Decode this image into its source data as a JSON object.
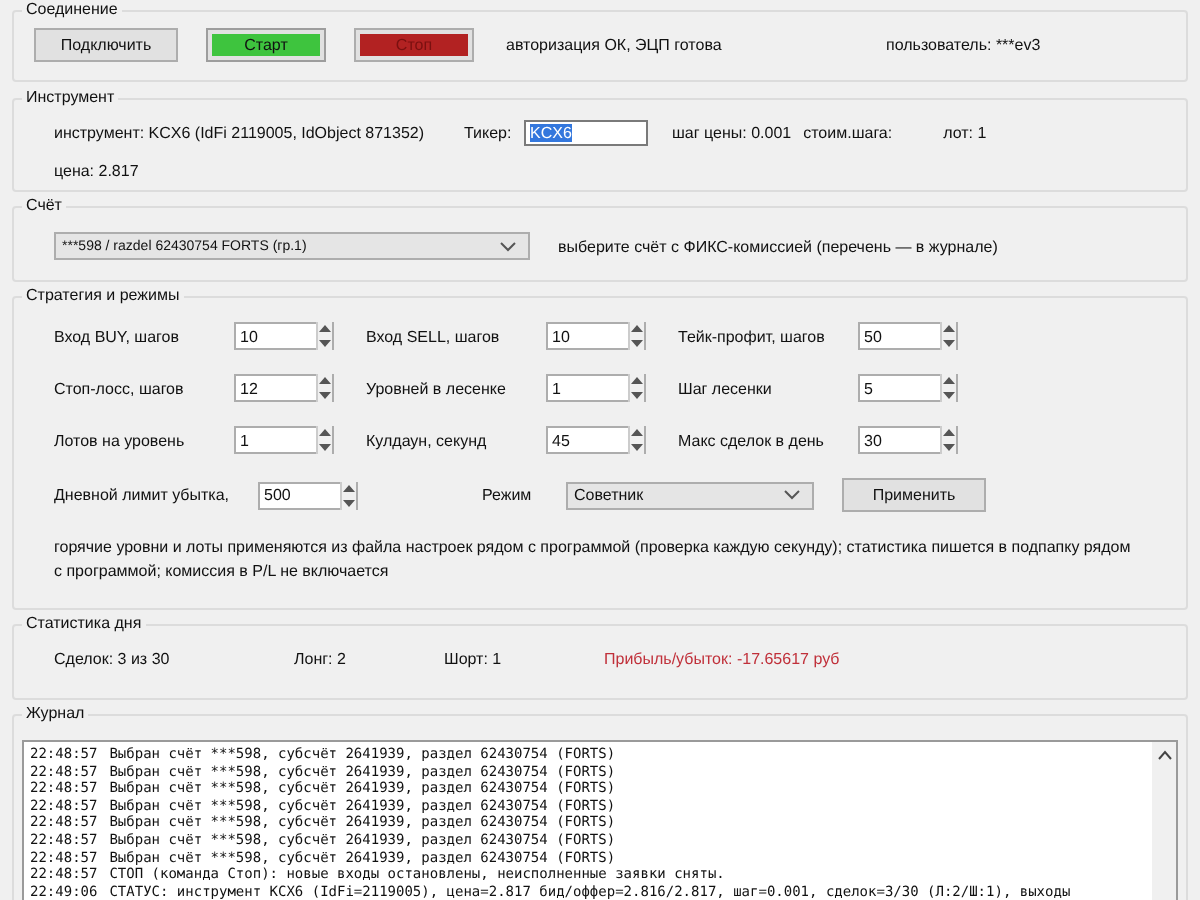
{
  "connection": {
    "title": "Соединение",
    "buttons": [
      {
        "label": "Подключить",
        "kind": "default"
      },
      {
        "label": "Старт",
        "kind": "start"
      },
      {
        "label": "Стоп",
        "kind": "stop"
      }
    ],
    "status": "авторизация ОК, ЭЦП готова",
    "user": "пользователь: ***ev3"
  },
  "instrument": {
    "title": "Инструмент",
    "info": "инструмент: KCX6 (IdFi 2119005, IdObject 871352)",
    "ticker_label": "Тикер:",
    "ticker_value": "KCX6",
    "ticker_text_selected": true,
    "price_step": "шаг цены: 0.001",
    "step_cost": "стоим.шага:",
    "lot": "лот: 1",
    "price": "цена: 2.817"
  },
  "account": {
    "title": "Счёт",
    "value": "***598 / razdel 62430754  FORTS (гр.1)",
    "hint": "выберите счёт с ФИКС-комиссией (перечень — в журнале)"
  },
  "strategy": {
    "title": "Стратегия и режимы",
    "fields": [
      {
        "label": "Вход BUY, шагов",
        "value": "10"
      },
      {
        "label": "Вход SELL, шагов",
        "value": "10"
      },
      {
        "label": "Тейк-профит, шагов",
        "value": "50"
      },
      {
        "label": "Стоп-лосс, шагов",
        "value": "12"
      },
      {
        "label": "Уровней в лесенке",
        "value": "1"
      },
      {
        "label": "Шаг лесенки",
        "value": "5"
      },
      {
        "label": "Лотов на уровень",
        "value": "1"
      },
      {
        "label": "Кулдаун, секунд",
        "value": "45"
      },
      {
        "label": "Макс сделок в день",
        "value": "30"
      }
    ],
    "loss_limit_label": "Дневной лимит убытка,",
    "loss_limit_value": "500",
    "mode_label": "Режим",
    "mode_value": "Советник",
    "apply": "Применить",
    "note": "горячие уровни и лоты применяются из файла настроек рядом с программой (проверка каждую секунду); статистика пишется в подпапку рядом с программой; комиссия в P/L не включается"
  },
  "stats": {
    "title": "Статистика дня",
    "items": [
      {
        "text": "Сделок: 3 из 30",
        "kind": "plain"
      },
      {
        "text": "Лонг: 2",
        "kind": "plain"
      },
      {
        "text": "Шорт: 1",
        "kind": "plain"
      },
      {
        "text": "Прибыль/убыток: -17.65617 руб",
        "kind": "loss"
      }
    ]
  },
  "journal": {
    "title": "Журнал",
    "lines": [
      {
        "time": "22:48:57",
        "text": "Выбран счёт ***598, субсчёт 2641939, раздел 62430754 (FORTS)"
      },
      {
        "time": "22:48:57",
        "text": "Выбран счёт ***598, субсчёт 2641939, раздел 62430754 (FORTS)"
      },
      {
        "time": "22:48:57",
        "text": "Выбран счёт ***598, субсчёт 2641939, раздел 62430754 (FORTS)"
      },
      {
        "time": "22:48:57",
        "text": "Выбран счёт ***598, субсчёт 2641939, раздел 62430754 (FORTS)"
      },
      {
        "time": "22:48:57",
        "text": "Выбран счёт ***598, субсчёт 2641939, раздел 62430754 (FORTS)"
      },
      {
        "time": "22:48:57",
        "text": "Выбран счёт ***598, субсчёт 2641939, раздел 62430754 (FORTS)"
      },
      {
        "time": "22:48:57",
        "text": "Выбран счёт ***598, субсчёт 2641939, раздел 62430754 (FORTS)"
      },
      {
        "time": "22:48:57",
        "text": "СТОП (команда Стоп): новые входы остановлены, неисполненные заявки сняты."
      },
      {
        "time": "22:49:06",
        "text": "СТАТУС: инструмент KCX6 (IdFi=2119005), цена=2.817 бид/оффер=2.816/2.817, шаг=0.001, сделок=3/30 (Л:2/Ш:1), выходы"
      }
    ]
  }
}
